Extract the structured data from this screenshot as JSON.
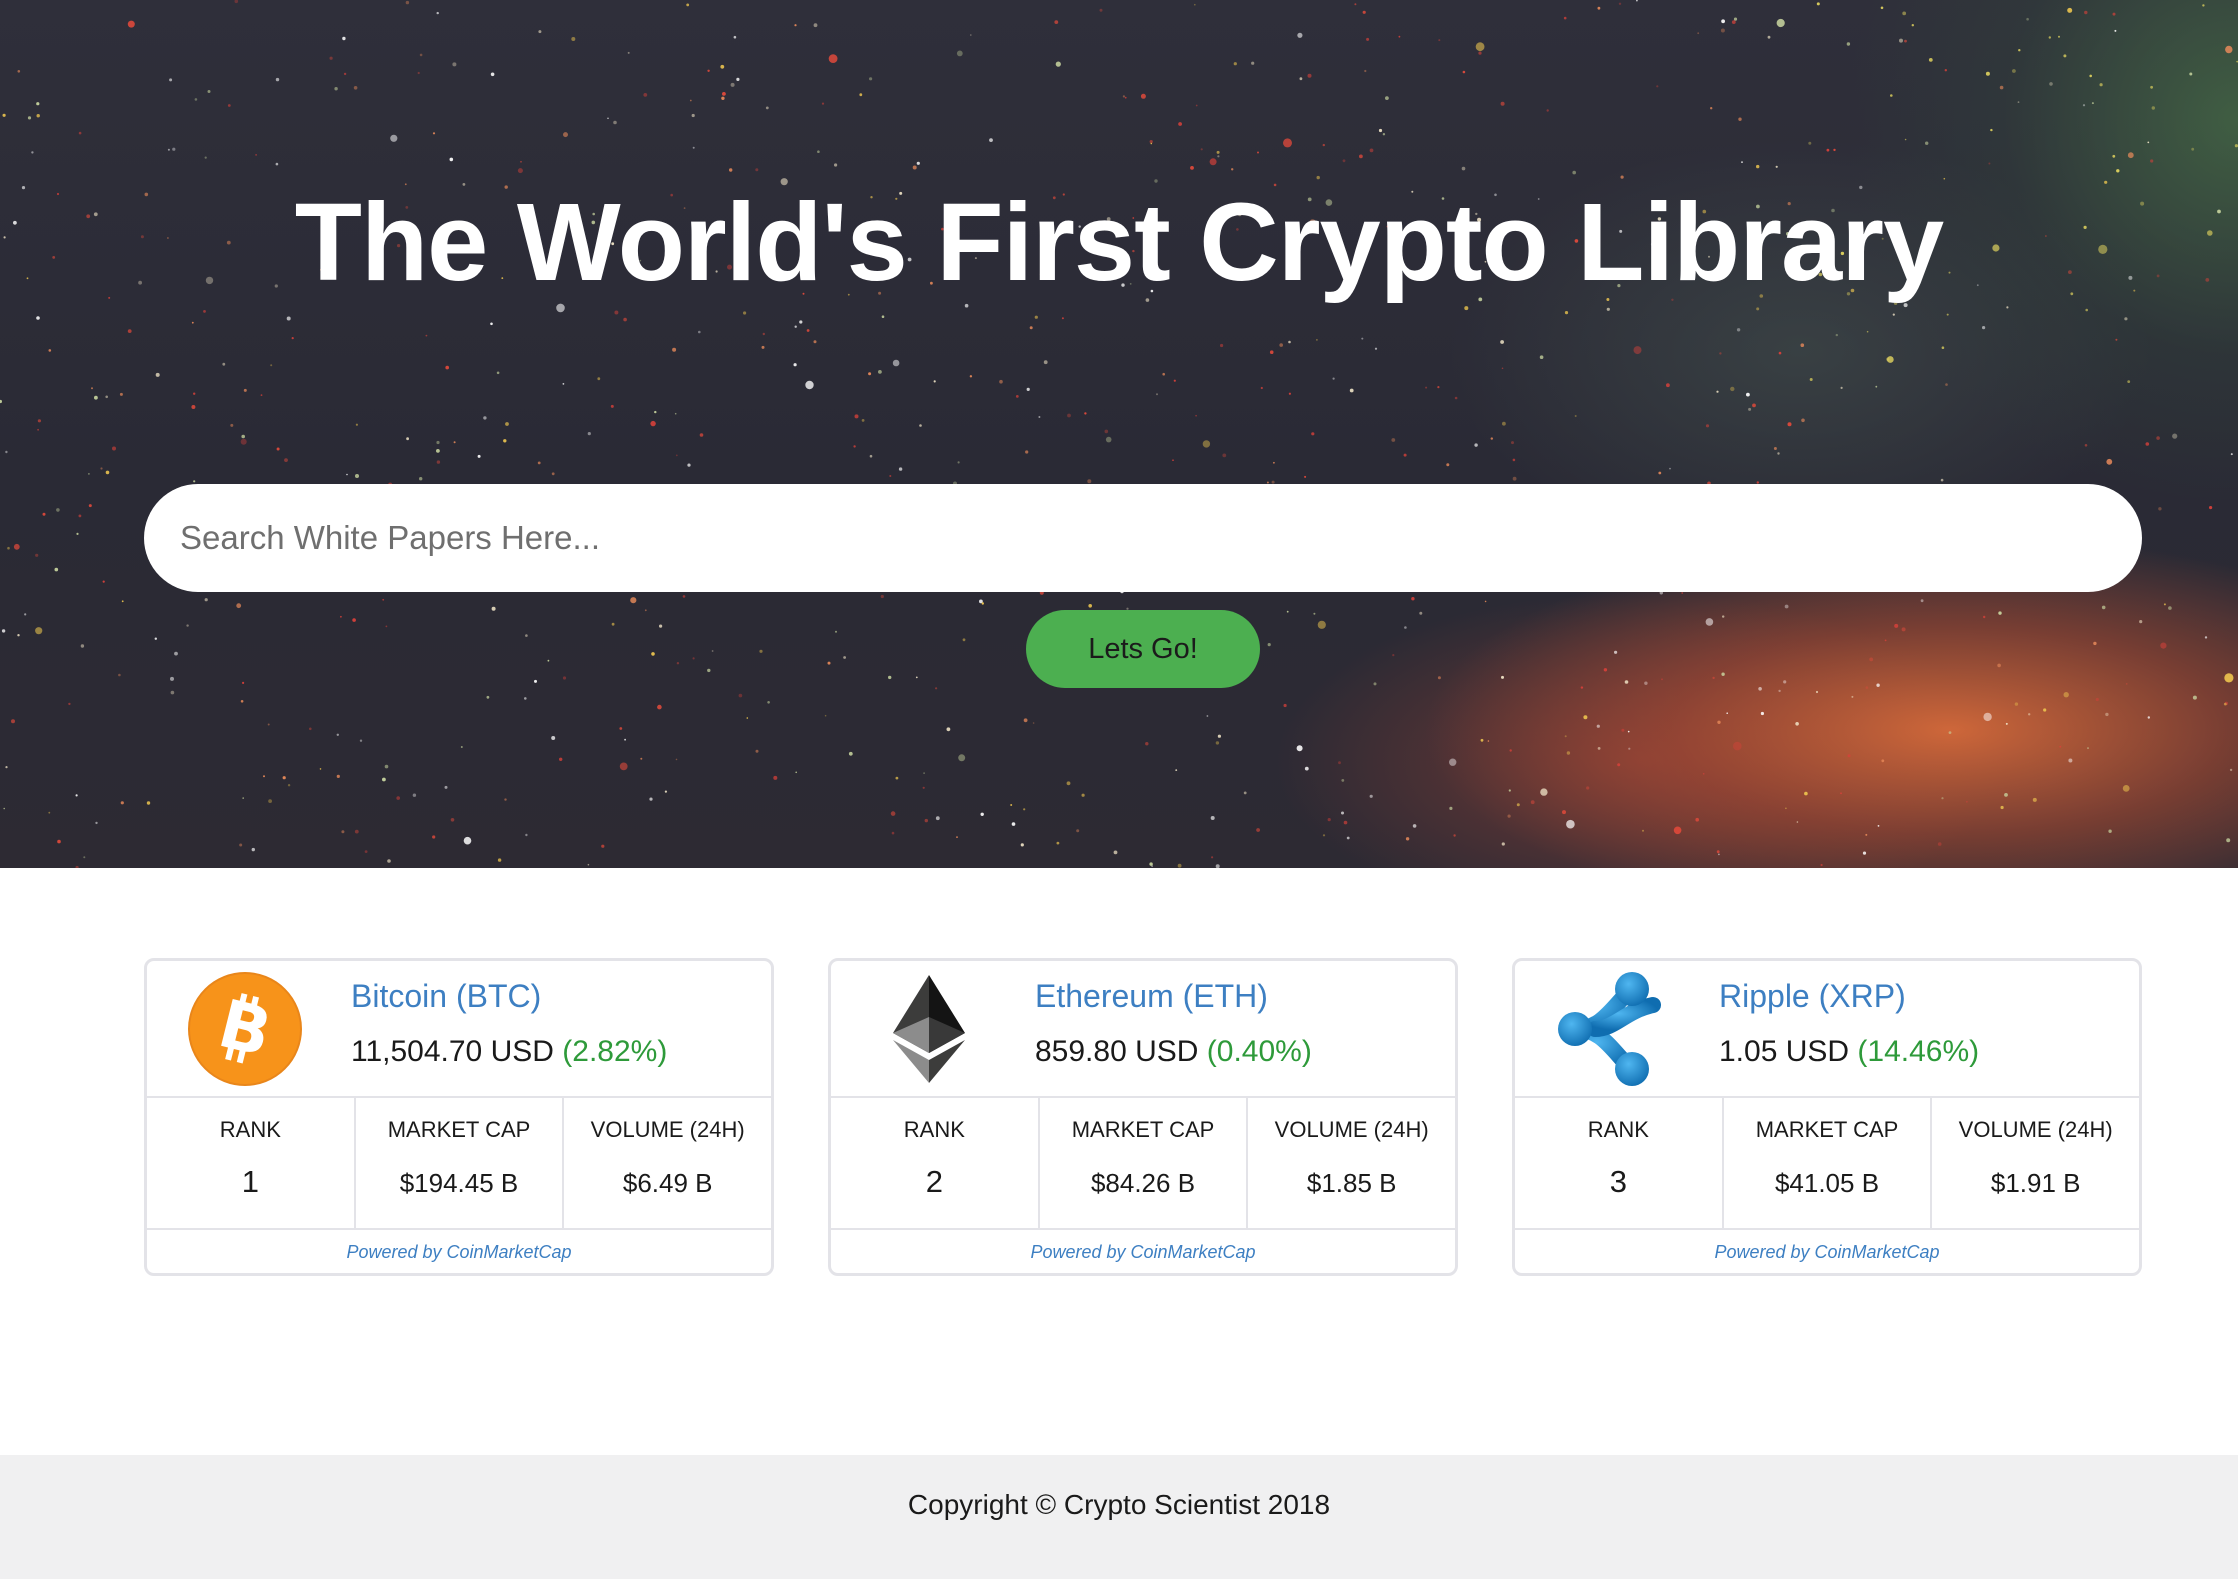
{
  "hero": {
    "title": "The World's First Crypto Library"
  },
  "search": {
    "placeholder": "Search White Papers Here...",
    "value": "",
    "button_label": "Lets Go!"
  },
  "coins": [
    {
      "name": "Bitcoin (BTC)",
      "price": "11,504.70 USD",
      "change": "(2.82%)",
      "rank_label": "RANK",
      "rank": "1",
      "market_cap_label": "MARKET CAP",
      "market_cap": "$194.45 B",
      "volume_label": "VOLUME (24H)",
      "volume": "$6.49 B",
      "powered_by": "Powered by CoinMarketCap",
      "icon": "bitcoin-icon"
    },
    {
      "name": "Ethereum (ETH)",
      "price": "859.80 USD",
      "change": "(0.40%)",
      "rank_label": "RANK",
      "rank": "2",
      "market_cap_label": "MARKET CAP",
      "market_cap": "$84.26 B",
      "volume_label": "VOLUME (24H)",
      "volume": "$1.85 B",
      "powered_by": "Powered by CoinMarketCap",
      "icon": "ethereum-icon"
    },
    {
      "name": "Ripple (XRP)",
      "price": "1.05 USD",
      "change": "(14.46%)",
      "rank_label": "RANK",
      "rank": "3",
      "market_cap_label": "MARKET CAP",
      "market_cap": "$41.05 B",
      "volume_label": "VOLUME (24H)",
      "volume": "$1.91 B",
      "powered_by": "Powered by CoinMarketCap",
      "icon": "ripple-icon"
    }
  ],
  "footer": {
    "copyright": "Copyright © Crypto Scientist 2018"
  },
  "colors": {
    "accent_blue": "#3d7fc2",
    "positive_green": "#2e9a3a",
    "button_green": "#4caf50",
    "bitcoin_orange": "#f7931a",
    "ripple_blue": "#1e8fd8"
  }
}
